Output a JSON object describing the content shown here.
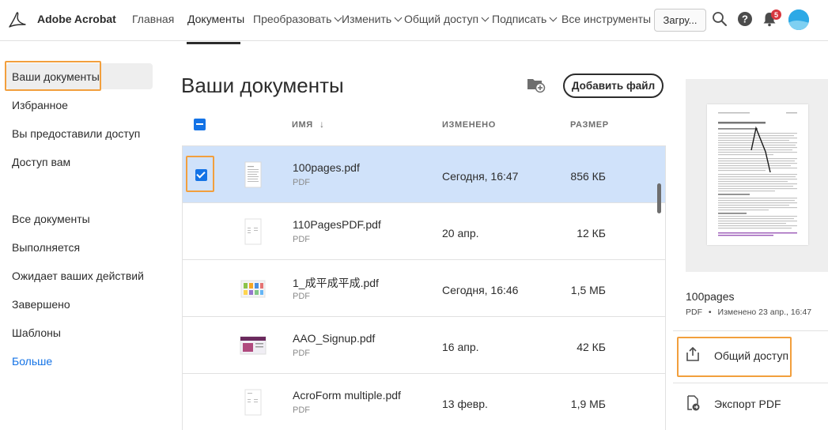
{
  "app": {
    "title": "Adobe Acrobat"
  },
  "nav": {
    "home": "Главная",
    "documents": "Документы",
    "convert": "Преобразовать",
    "edit": "Изменить",
    "share": "Общий доступ",
    "sign": "Подписать",
    "all_tools": "Все инструменты",
    "upload": "Загру...",
    "notifications_count": "5"
  },
  "sidebar": {
    "your_documents": "Ваши документы",
    "favorites": "Избранное",
    "shared_by_you": "Вы предоставили доступ",
    "shared_with_you": "Доступ вам",
    "all_documents": "Все документы",
    "in_progress": "Выполняется",
    "awaiting": "Ожидает ваших действий",
    "completed": "Завершено",
    "templates": "Шаблоны",
    "more": "Больше"
  },
  "main": {
    "title": "Ваши документы",
    "add_file": "Добавить файл",
    "columns": {
      "name": "ИМЯ",
      "modified": "ИЗМЕНЕНО",
      "size": "РАЗМЕР"
    },
    "files": [
      {
        "name": "100pages.pdf",
        "type": "PDF",
        "modified": "Сегодня, 16:47",
        "size": "856 КБ",
        "selected": true
      },
      {
        "name": "110PagesPDF.pdf",
        "type": "PDF",
        "modified": "20 апр.",
        "size": "12 КБ",
        "selected": false
      },
      {
        "name": "1_成平成平成.pdf",
        "type": "PDF",
        "modified": "Сегодня, 16:46",
        "size": "1,5 МБ",
        "selected": false
      },
      {
        "name": "AAO_Signup.pdf",
        "type": "PDF",
        "modified": "16 апр.",
        "size": "42 КБ",
        "selected": false
      },
      {
        "name": "AcroForm multiple.pdf",
        "type": "PDF",
        "modified": "13 февр.",
        "size": "1,9 МБ",
        "selected": false
      }
    ]
  },
  "panel": {
    "file_name": "100pages",
    "file_type": "PDF",
    "modified": "Изменено 23 апр., 16:47",
    "share": "Общий доступ",
    "export_pdf": "Экспорт PDF"
  },
  "colors": {
    "accent_blue": "#1473e6",
    "highlight_orange": "#f29f3d",
    "selected_row": "#d0e2fa",
    "badge_red": "#d7373f"
  }
}
